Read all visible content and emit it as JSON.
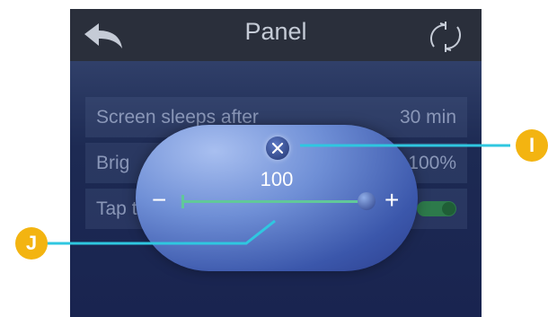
{
  "header": {
    "title": "Panel",
    "back_icon": "back-arrow-icon",
    "refresh_icon": "refresh-icon"
  },
  "settings": [
    {
      "label": "Screen sleeps after",
      "value": "30 min"
    },
    {
      "label": "Brig",
      "value": "100%"
    },
    {
      "label": "Tap t",
      "toggle": true
    }
  ],
  "overlay": {
    "value": "100",
    "minus": "−",
    "plus": "+",
    "close": "×",
    "slider_level": 1.0
  },
  "callouts": {
    "i": "I",
    "j": "J"
  },
  "colors": {
    "accent": "#61c89a",
    "marker": "#f3b411",
    "callout_line": "#2fc7e0"
  }
}
